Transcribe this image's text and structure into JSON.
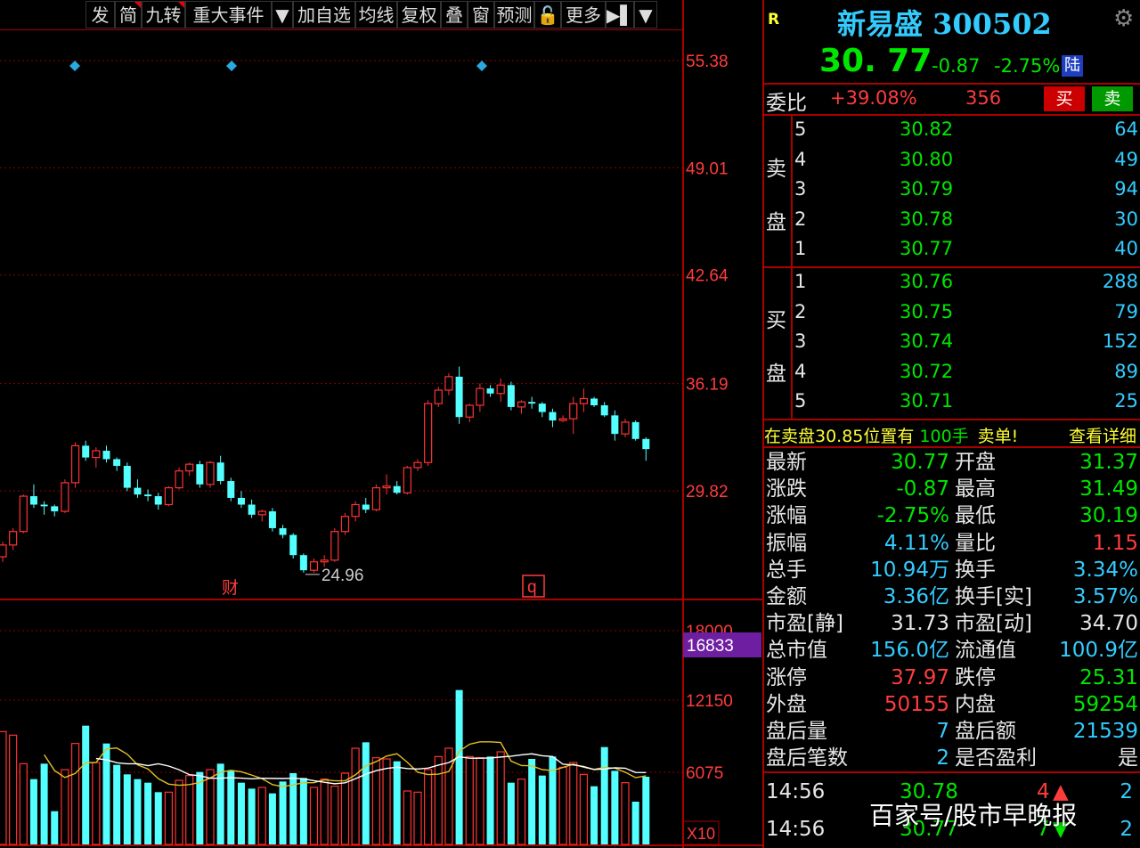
{
  "toolbar": {
    "items": [
      {
        "label": "发",
        "flag": false
      },
      {
        "label": "简",
        "flag": true
      },
      {
        "label": "九转",
        "flag": true
      },
      {
        "label": "重大事件",
        "flag": false
      },
      {
        "label": "▼",
        "flag": false
      },
      {
        "label": "加自选",
        "flag": false
      },
      {
        "label": "均线",
        "flag": false
      },
      {
        "label": "复权",
        "flag": false
      },
      {
        "label": "叠",
        "flag": false
      },
      {
        "label": "窗",
        "flag": false
      },
      {
        "label": "预测",
        "flag": false
      },
      {
        "label": "🔓",
        "flag": false
      },
      {
        "label": "更多",
        "flag": false
      },
      {
        "label": "▶▌",
        "flag": false
      },
      {
        "label": "▼",
        "flag": false
      }
    ]
  },
  "chart_data": {
    "type": "candlestick",
    "price_axis_ticks": [
      "55.38",
      "49.01",
      "42.64",
      "36.19",
      "29.82"
    ],
    "volume_axis_ticks": [
      "18000",
      "12150",
      "6075"
    ],
    "volume_highlight": "16833",
    "volume_unit": "X10",
    "low_marker_label": "24.96",
    "event_labels": [
      "财",
      "q"
    ],
    "candles": [
      [
        25.9,
        26.8,
        25.6,
        26.6
      ],
      [
        26.6,
        27.6,
        26.3,
        27.4
      ],
      [
        27.4,
        29.6,
        27.3,
        29.5
      ],
      [
        29.5,
        30.2,
        28.8,
        29.0
      ],
      [
        29.0,
        29.2,
        28.4,
        28.9
      ],
      [
        28.9,
        29.0,
        28.3,
        28.6
      ],
      [
        28.6,
        30.5,
        28.5,
        30.3
      ],
      [
        30.3,
        32.7,
        30.0,
        32.5
      ],
      [
        32.5,
        32.8,
        31.6,
        31.8
      ],
      [
        31.8,
        32.4,
        31.2,
        32.2
      ],
      [
        32.2,
        32.5,
        31.5,
        31.7
      ],
      [
        31.7,
        31.8,
        31.0,
        31.3
      ],
      [
        31.3,
        31.5,
        29.8,
        30.0
      ],
      [
        30.0,
        30.5,
        29.4,
        29.6
      ],
      [
        29.6,
        29.9,
        29.2,
        29.5
      ],
      [
        29.5,
        29.7,
        28.7,
        29.0
      ],
      [
        29.0,
        30.1,
        28.9,
        30.0
      ],
      [
        30.0,
        31.2,
        29.9,
        31.0
      ],
      [
        31.0,
        31.5,
        30.7,
        31.4
      ],
      [
        31.4,
        31.6,
        30.0,
        30.2
      ],
      [
        30.2,
        31.6,
        30.0,
        31.5
      ],
      [
        31.5,
        31.9,
        30.2,
        30.4
      ],
      [
        30.4,
        30.6,
        29.2,
        29.4
      ],
      [
        29.4,
        29.8,
        28.8,
        29.0
      ],
      [
        29.0,
        29.3,
        28.2,
        28.4
      ],
      [
        28.4,
        28.7,
        28.0,
        28.6
      ],
      [
        28.6,
        28.8,
        27.4,
        27.6
      ],
      [
        27.6,
        27.8,
        27.0,
        27.2
      ],
      [
        27.2,
        27.3,
        25.8,
        26.0
      ],
      [
        26.0,
        26.1,
        24.96,
        25.1
      ],
      [
        25.1,
        25.8,
        24.96,
        25.6
      ],
      [
        25.6,
        26.0,
        25.3,
        25.7
      ],
      [
        25.7,
        27.6,
        25.6,
        27.4
      ],
      [
        27.4,
        28.5,
        27.2,
        28.3
      ],
      [
        28.3,
        29.2,
        28.0,
        29.0
      ],
      [
        29.0,
        29.4,
        28.5,
        28.7
      ],
      [
        28.7,
        30.2,
        28.6,
        30.0
      ],
      [
        30.0,
        30.8,
        29.6,
        30.1
      ],
      [
        30.1,
        30.4,
        29.6,
        29.7
      ],
      [
        29.7,
        31.3,
        29.6,
        31.2
      ],
      [
        31.2,
        31.7,
        31.0,
        31.5
      ],
      [
        31.5,
        35.2,
        31.3,
        35.0
      ],
      [
        35.0,
        36.0,
        34.8,
        35.8
      ],
      [
        35.8,
        36.8,
        35.5,
        36.6
      ],
      [
        36.6,
        37.2,
        33.8,
        34.2
      ],
      [
        34.2,
        35.0,
        33.9,
        34.9
      ],
      [
        34.9,
        36.2,
        34.5,
        35.9
      ],
      [
        35.9,
        36.1,
        35.4,
        35.6
      ],
      [
        35.6,
        36.5,
        35.1,
        36.1
      ],
      [
        36.1,
        36.3,
        34.6,
        34.8
      ],
      [
        34.8,
        35.2,
        34.4,
        35.1
      ],
      [
        35.1,
        35.4,
        34.7,
        35.0
      ],
      [
        35.0,
        35.1,
        34.2,
        34.5
      ],
      [
        34.5,
        34.7,
        33.6,
        34.0
      ],
      [
        34.0,
        34.3,
        33.9,
        34.1
      ],
      [
        34.1,
        35.4,
        33.2,
        35.0
      ],
      [
        35.0,
        35.9,
        34.5,
        35.3
      ],
      [
        35.3,
        35.4,
        34.8,
        34.9
      ],
      [
        34.9,
        35.1,
        34.2,
        34.3
      ],
      [
        34.3,
        34.6,
        32.8,
        33.2
      ],
      [
        33.2,
        34.1,
        33.0,
        33.9
      ],
      [
        33.9,
        34.0,
        32.8,
        32.9
      ],
      [
        32.9,
        33.0,
        31.6,
        32.3
      ]
    ],
    "volumes": [
      95,
      92,
      68,
      55,
      68,
      28,
      63,
      85,
      100,
      69,
      85,
      67,
      59,
      55,
      52,
      44,
      44,
      54,
      58,
      61,
      63,
      68,
      62,
      52,
      47,
      48,
      43,
      53,
      60,
      56,
      48,
      55,
      49,
      60,
      81,
      86,
      73,
      72,
      70,
      45,
      44,
      63,
      74,
      81,
      130,
      74,
      73,
      74,
      78,
      52,
      55,
      72,
      58,
      74,
      65,
      69,
      59,
      49,
      82,
      62,
      52,
      36,
      57
    ]
  },
  "quote": {
    "badge": "R",
    "name_code": "新易盛 300502",
    "price": "30. 77",
    "change": "-0.87",
    "change_pct": "-2.75%",
    "market_tag": "陆"
  },
  "weibi": {
    "label": "委比",
    "pct": "+39.08%",
    "diff": "356",
    "buy_btn": "买",
    "sell_btn": "卖"
  },
  "sell_label": [
    "卖",
    "盘"
  ],
  "buy_label": [
    "买",
    "盘"
  ],
  "asks": [
    {
      "lvl": "5",
      "price": "30.82",
      "qty": "64"
    },
    {
      "lvl": "4",
      "price": "30.80",
      "qty": "49"
    },
    {
      "lvl": "3",
      "price": "30.79",
      "qty": "94"
    },
    {
      "lvl": "2",
      "price": "30.78",
      "qty": "30"
    },
    {
      "lvl": "1",
      "price": "30.77",
      "qty": "40"
    }
  ],
  "bids": [
    {
      "lvl": "1",
      "price": "30.76",
      "qty": "288"
    },
    {
      "lvl": "2",
      "price": "30.75",
      "qty": "79"
    },
    {
      "lvl": "3",
      "price": "30.74",
      "qty": "152"
    },
    {
      "lvl": "4",
      "price": "30.72",
      "qty": "89"
    },
    {
      "lvl": "5",
      "price": "30.71",
      "qty": "25"
    }
  ],
  "notice": {
    "prefix": "在卖盘30.85位置有",
    "hands": "100手",
    "suffix": "卖单!",
    "detail": "查看详细"
  },
  "stats": [
    {
      "l1": "最新",
      "v1": "30.77",
      "c1": "green",
      "l2": "开盘",
      "v2": "31.37",
      "c2": "green"
    },
    {
      "l1": "涨跌",
      "v1": "-0.87",
      "c1": "green",
      "l2": "最高",
      "v2": "31.49",
      "c2": "green"
    },
    {
      "l1": "涨幅",
      "v1": "-2.75%",
      "c1": "green",
      "l2": "最低",
      "v2": "30.19",
      "c2": "green"
    },
    {
      "l1": "振幅",
      "v1": "4.11%",
      "c1": "cyan",
      "l2": "量比",
      "v2": "1.15",
      "c2": "red"
    },
    {
      "l1": "总手",
      "v1": "10.94万",
      "c1": "cyan",
      "l2": "换手",
      "v2": "3.34%",
      "c2": "cyan"
    },
    {
      "l1": "金额",
      "v1": "3.36亿",
      "c1": "cyan",
      "l2": "换手[实]",
      "v2": "3.57%",
      "c2": "cyan"
    },
    {
      "l1": "市盈[静]",
      "v1": "31.73",
      "c1": "white",
      "l2": "市盈[动]",
      "v2": "34.70",
      "c2": "white"
    },
    {
      "l1": "总市值",
      "v1": "156.0亿",
      "c1": "cyan",
      "l2": "流通值",
      "v2": "100.9亿",
      "c2": "cyan"
    },
    {
      "l1": "涨停",
      "v1": "37.97",
      "c1": "red",
      "l2": "跌停",
      "v2": "25.31",
      "c2": "green"
    },
    {
      "l1": "外盘",
      "v1": "50155",
      "c1": "red",
      "l2": "内盘",
      "v2": "59254",
      "c2": "green"
    },
    {
      "l1": "盘后量",
      "v1": "7",
      "c1": "cyan",
      "l2": "盘后额",
      "v2": "21539",
      "c2": "cyan"
    },
    {
      "l1": "盘后笔数",
      "v1": "2",
      "c1": "cyan",
      "l2": "是否盈利",
      "v2": "是",
      "c2": "white"
    }
  ],
  "ticks": [
    {
      "time": "14:56",
      "price": "30.78",
      "vol": "4",
      "dir": "up",
      "n": "2"
    },
    {
      "time": "14:56",
      "price": "30.77",
      "vol": "7",
      "dir": "down",
      "n": "2"
    }
  ],
  "watermark": "百家号/股市早晚报",
  "colors": {
    "up": "#ff3232",
    "down": "#54ffff",
    "grid": "#8b0000",
    "ma1": "#ffffff",
    "ma2": "#e0c020",
    "panel_red": "#ff3c3c",
    "panel_green": "#00e600",
    "panel_cyan": "#33ccff"
  }
}
